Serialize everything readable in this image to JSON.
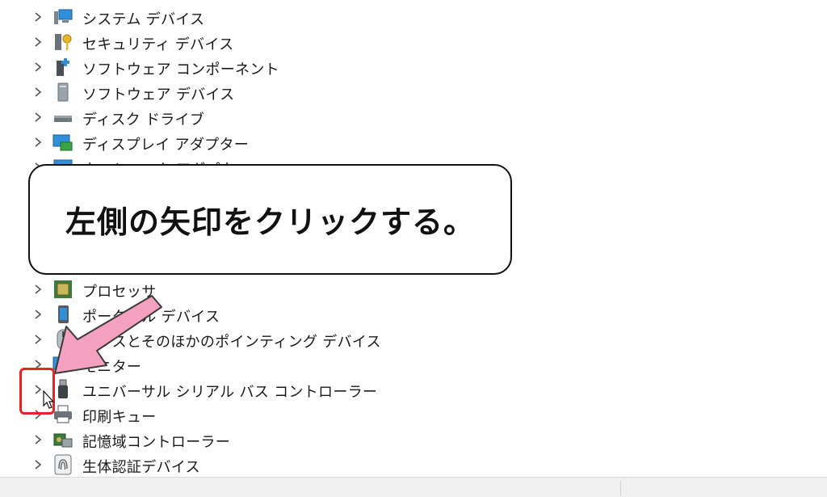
{
  "device_manager": {
    "categories": [
      {
        "label": "システム デバイス",
        "icon": "system-device-icon"
      },
      {
        "label": "セキュリティ デバイス",
        "icon": "security-key-icon"
      },
      {
        "label": "ソフトウェア コンポーネント",
        "icon": "software-component-icon"
      },
      {
        "label": "ソフトウェア デバイス",
        "icon": "software-device-icon"
      },
      {
        "label": "ディスク ドライブ",
        "icon": "disk-drive-icon"
      },
      {
        "label": "ディスプレイ アダプター",
        "icon": "display-adapter-icon"
      },
      {
        "label": "ネットワーク アダプター",
        "icon": "network-adapter-icon"
      },
      {
        "label": "プロセッサ",
        "icon": "processor-icon"
      },
      {
        "label": "ポータブル デバイス",
        "icon": "portable-device-icon"
      },
      {
        "label": "マウスとそのほかのポインティング デバイス",
        "icon": "mouse-icon"
      },
      {
        "label": "モニター",
        "icon": "monitor-icon"
      },
      {
        "label": "ユニバーサル シリアル バス コントローラー",
        "icon": "usb-icon"
      },
      {
        "label": "印刷キュー",
        "icon": "printer-icon"
      },
      {
        "label": "記憶域コントローラー",
        "icon": "storage-controller-icon"
      },
      {
        "label": "生体認証デバイス",
        "icon": "fingerprint-icon"
      }
    ]
  },
  "annotation": {
    "callout_text": "左側の矢印をクリックする。",
    "arrow_color": "#f4a0bf",
    "highlight_color": "#e52424"
  }
}
